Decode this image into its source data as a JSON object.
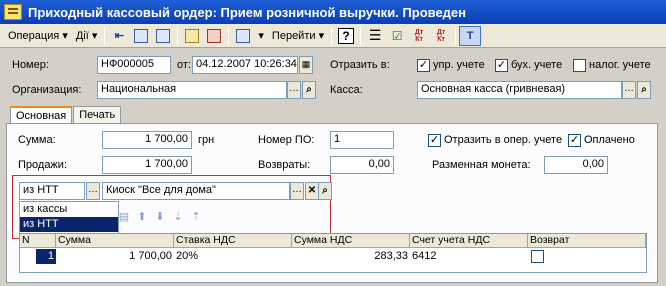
{
  "window": {
    "title": "Приходный кассовый ордер: Прием розничной выручки. Проведен"
  },
  "toolbar": {
    "operation_label": "Операция",
    "actions_label": "Дії",
    "goto_label": "Перейти",
    "help_label": "?",
    "dt_kt_1": "Дт Кт",
    "dt_kt_2": "Дт Кт"
  },
  "header": {
    "number_label": "Номер:",
    "number_value": "НФ000005",
    "date_label": "от:",
    "date_value": "04.12.2007 10:26:34",
    "reflect_label": "Отразить в:",
    "upr_label": "упр. учете",
    "buh_label": "бух. учете",
    "nalog_label": "налог. учете",
    "org_label": "Организация:",
    "org_value": "Национальная",
    "kassa_label": "Касса:",
    "kassa_value": "Основная касса (гривневая)"
  },
  "tabs": [
    "Основная",
    "Печать"
  ],
  "main": {
    "summa_label": "Сумма:",
    "summa_value": "1 700,00",
    "currency": "грн",
    "nomer_po_label": "Номер ПО:",
    "nomer_po_value": "1",
    "oper_label": "Отразить в опер. учете",
    "paid_label": "Оплачено",
    "prodazhi_label": "Продажи:",
    "prodazhi_value": "1 700,00",
    "vozvraty_label": "Возвраты:",
    "vozvraty_value": "0,00",
    "razmen_label": "Разменная монета:",
    "razmen_value": "0,00",
    "source_value": "из НТТ",
    "kiosk_value": "Киоск \"Все для дома\"",
    "dropdown_options": [
      "из кассы",
      "из НТТ"
    ]
  },
  "grid": {
    "columns": [
      "N",
      "Сумма",
      "Ставка НДС",
      "Сумма НДС",
      "Счет учета НДС",
      "Возврат"
    ],
    "rows": [
      {
        "n": "1",
        "summa": "1 700,00",
        "stavka": "20%",
        "summa_nds": "283,33",
        "schet": "6412"
      }
    ]
  }
}
